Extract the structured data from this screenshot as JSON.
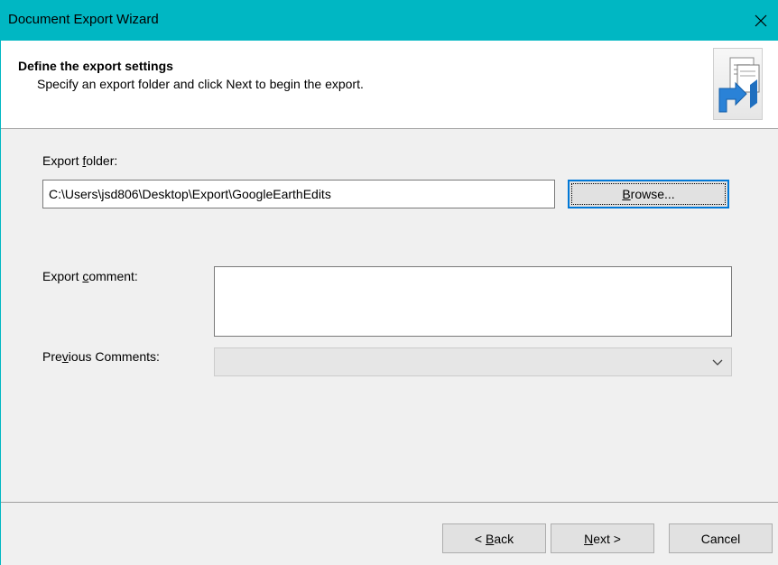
{
  "window": {
    "title": "Document Export Wizard",
    "accent_color": "#00b7c3"
  },
  "header": {
    "title": "Define the export settings",
    "subtitle": "Specify an export folder and click Next to begin the export.",
    "icon": "document-export-icon"
  },
  "form": {
    "export_folder": {
      "label_pre": "Export ",
      "label_key": "f",
      "label_post": "older:",
      "value": "C:\\Users\\jsd806\\Desktop\\Export\\GoogleEarthEdits",
      "browse_pre": "",
      "browse_key": "B",
      "browse_post": "rowse..."
    },
    "export_comment": {
      "label_pre": "Export ",
      "label_key": "c",
      "label_post": "omment:",
      "value": ""
    },
    "previous_comments": {
      "label_pre": "Pre",
      "label_key": "v",
      "label_post": "ious Comments:",
      "selected": ""
    }
  },
  "buttons": {
    "back_pre": "< ",
    "back_key": "B",
    "back_post": "ack",
    "next_pre": "",
    "next_key": "N",
    "next_post": "ext >",
    "cancel": "Cancel"
  }
}
